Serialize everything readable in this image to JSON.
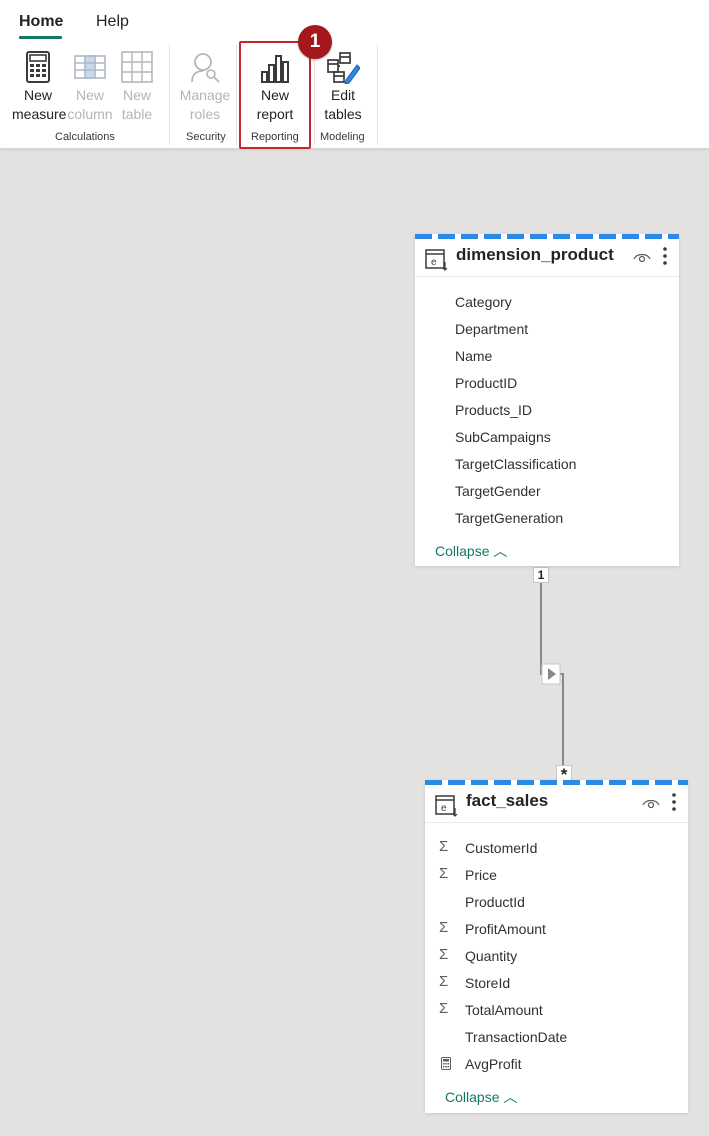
{
  "ribbon": {
    "tabs": [
      {
        "label": "Home",
        "active": true
      },
      {
        "label": "Help",
        "active": false
      }
    ],
    "buttons": {
      "new_measure": {
        "line1": "New",
        "line2": "measure",
        "icon": "calculator-icon"
      },
      "new_column": {
        "line1": "New",
        "line2": "column",
        "icon": "table-column-icon"
      },
      "new_table": {
        "line1": "New",
        "line2": "table",
        "icon": "table-grid-icon"
      },
      "manage_roles": {
        "line1": "Manage",
        "line2": "roles",
        "icon": "person-search-icon"
      },
      "new_report": {
        "line1": "New",
        "line2": "report",
        "icon": "bar-chart-icon"
      },
      "edit_tables": {
        "line1": "Edit",
        "line2": "tables",
        "icon": "edit-tables-icon"
      }
    },
    "groups": {
      "calculations": "Calculations",
      "security": "Security",
      "reporting": "Reporting",
      "modeling": "Modeling"
    },
    "step_badge": "1",
    "accent_color": "#117865",
    "highlight_color": "#c4262e"
  },
  "model": {
    "dimension_product": {
      "title": "dimension_product",
      "fields": [
        "Category",
        "Department",
        "Name",
        "ProductID",
        "Products_ID",
        "SubCampaigns",
        "TargetClassification",
        "TargetGender",
        "TargetGeneration"
      ],
      "collapse_label": "Collapse"
    },
    "fact_sales": {
      "title": "fact_sales",
      "fields": [
        {
          "name": "CustomerId",
          "icon": "sigma-icon"
        },
        {
          "name": "Price",
          "icon": "sigma-icon"
        },
        {
          "name": "ProductId",
          "icon": ""
        },
        {
          "name": "ProfitAmount",
          "icon": "sigma-icon"
        },
        {
          "name": "Quantity",
          "icon": "sigma-icon"
        },
        {
          "name": "StoreId",
          "icon": "sigma-icon"
        },
        {
          "name": "TotalAmount",
          "icon": "sigma-icon"
        },
        {
          "name": "TransactionDate",
          "icon": ""
        },
        {
          "name": "AvgProfit",
          "icon": "calculator-icon"
        }
      ],
      "collapse_label": "Collapse"
    },
    "relationship": {
      "from_cardinality": "1",
      "to_cardinality": "*"
    },
    "sigma_symbol": "Σ",
    "collapse_chevron": "︿"
  }
}
